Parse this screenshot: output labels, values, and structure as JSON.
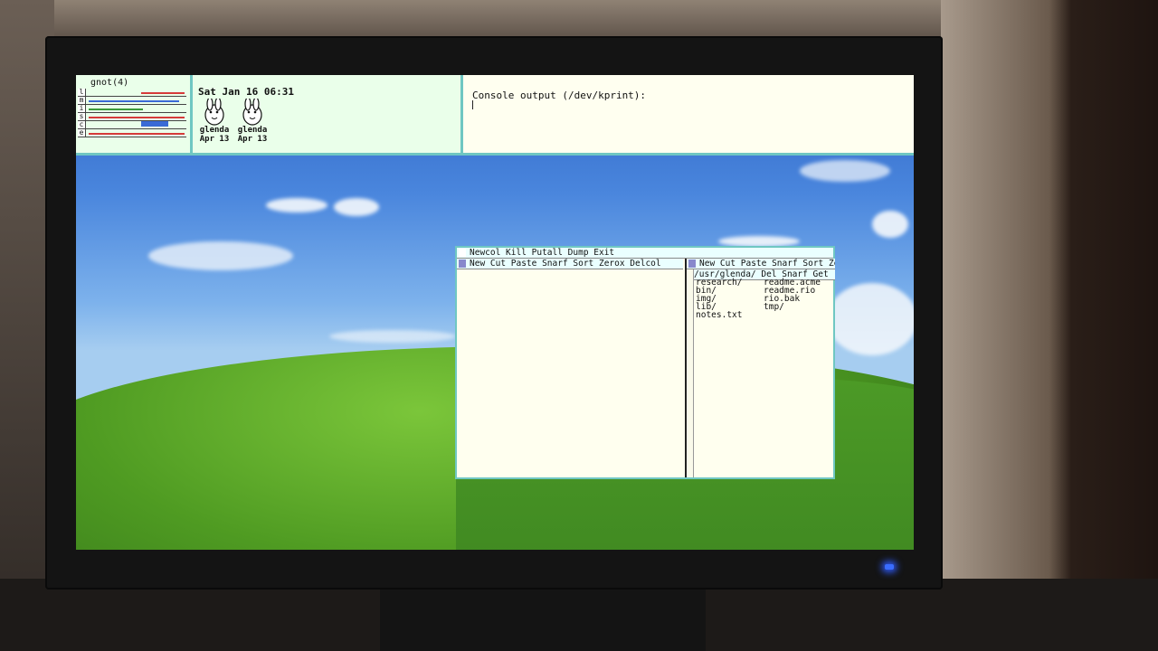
{
  "top_bar": {
    "gnot": {
      "title": "gnot(4)",
      "stats": [
        {
          "label": "l",
          "color": "#d63a3a"
        },
        {
          "label": "m",
          "color": "#3a6ad6"
        },
        {
          "label": "i",
          "color": "#3a9a3a"
        },
        {
          "label": "s",
          "color": "#d63a3a"
        },
        {
          "label": "c",
          "color": "#3a6ad6"
        },
        {
          "label": "e",
          "color": "#d63a3a"
        }
      ]
    },
    "clock": {
      "datetime": "Sat Jan 16 06:31",
      "users": [
        {
          "name": "glenda",
          "date": "Apr 13"
        },
        {
          "name": "glenda",
          "date": "Apr 13"
        }
      ]
    },
    "console": {
      "title": "Console output (/dev/kprint):"
    }
  },
  "acme": {
    "main_tag": "Newcol Kill Putall Dump Exit",
    "col1_tag": "New Cut Paste Snarf Sort Zerox Delcol",
    "col2_tag": "New Cut Paste Snarf Sort Zerox",
    "dir_tag": "/usr/glenda/ Del Snarf Get | Lo",
    "files_left": [
      "research/",
      "bin/",
      "img/",
      "lib/",
      "notes.txt"
    ],
    "files_right": [
      "readme.acme",
      "readme.rio",
      "rio.bak",
      "tmp/"
    ]
  },
  "colors": {
    "window_border": "#6fc7c2",
    "tag_bg": "#eaffff",
    "body_bg": "#ffffef",
    "power_led": "#3a6cff"
  }
}
